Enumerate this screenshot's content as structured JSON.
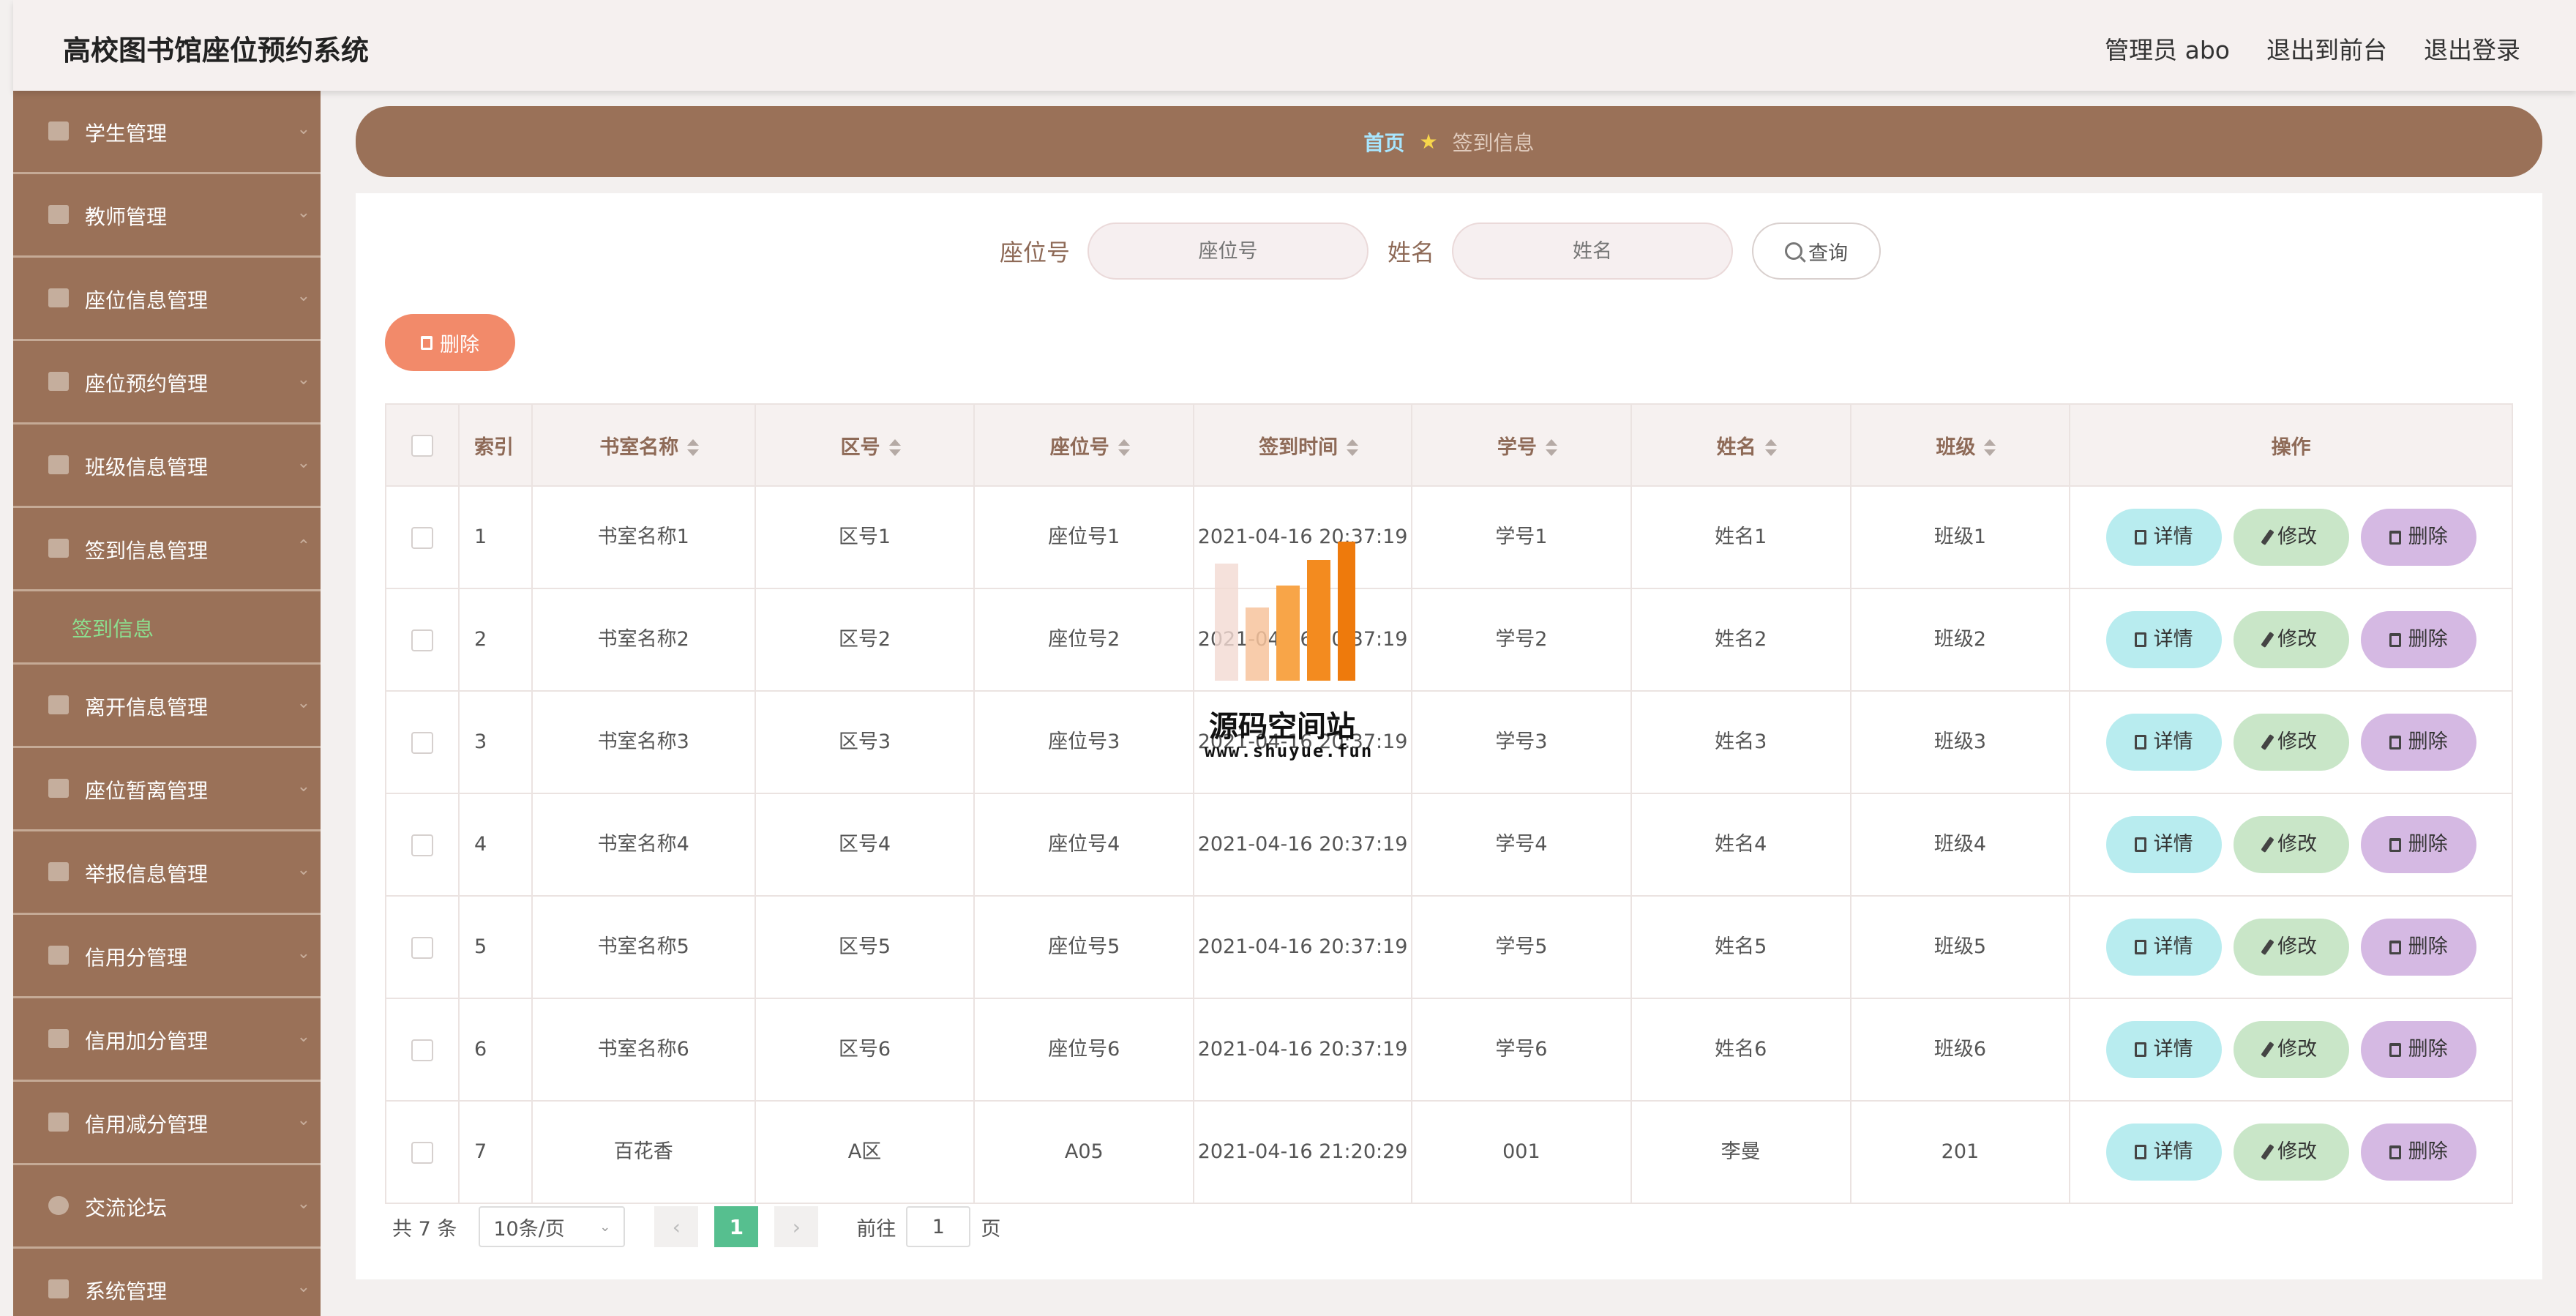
{
  "header": {
    "title": "高校图书馆座位预约系统",
    "links": [
      "管理员 abo",
      "退出到前台",
      "退出登录"
    ]
  },
  "sidebar": {
    "items": [
      {
        "label": "学生管理",
        "icon": "grid-icon"
      },
      {
        "label": "教师管理",
        "icon": "user-icon"
      },
      {
        "label": "座位信息管理",
        "icon": "send-icon"
      },
      {
        "label": "座位预约管理",
        "icon": "checklist-icon"
      },
      {
        "label": "班级信息管理",
        "icon": "send-icon"
      },
      {
        "label": "签到信息管理",
        "icon": "printer-icon",
        "expanded": true,
        "children": [
          "签到信息"
        ]
      },
      {
        "label": "离开信息管理",
        "icon": "briefcase-icon"
      },
      {
        "label": "座位暂离管理",
        "icon": "clipboard-icon"
      },
      {
        "label": "举报信息管理",
        "icon": "crop-icon"
      },
      {
        "label": "信用分管理",
        "icon": "video-icon"
      },
      {
        "label": "信用加分管理",
        "icon": "message-icon"
      },
      {
        "label": "信用减分管理",
        "icon": "cancel-icon"
      },
      {
        "label": "交流论坛",
        "icon": "compass-icon"
      },
      {
        "label": "系统管理",
        "icon": "card-icon"
      }
    ]
  },
  "breadcrumb": {
    "home": "首页",
    "current": "签到信息"
  },
  "search": {
    "seat_label": "座位号",
    "seat_placeholder": "座位号",
    "name_label": "姓名",
    "name_placeholder": "姓名",
    "button": "查询"
  },
  "toolbar": {
    "delete_label": "删除"
  },
  "table": {
    "headers": [
      "索引",
      "书室名称",
      "区号",
      "座位号",
      "签到时间",
      "学号",
      "姓名",
      "班级",
      "操作"
    ],
    "rows": [
      {
        "index": "1",
        "room": "书室名称1",
        "zone": "区号1",
        "seat": "座位号1",
        "time": "2021-04-16 20:37:19",
        "sid": "学号1",
        "name": "姓名1",
        "class": "班级1"
      },
      {
        "index": "2",
        "room": "书室名称2",
        "zone": "区号2",
        "seat": "座位号2",
        "time": "2021-04-16 20:37:19",
        "sid": "学号2",
        "name": "姓名2",
        "class": "班级2"
      },
      {
        "index": "3",
        "room": "书室名称3",
        "zone": "区号3",
        "seat": "座位号3",
        "time": "2021-04-16 20:37:19",
        "sid": "学号3",
        "name": "姓名3",
        "class": "班级3"
      },
      {
        "index": "4",
        "room": "书室名称4",
        "zone": "区号4",
        "seat": "座位号4",
        "time": "2021-04-16 20:37:19",
        "sid": "学号4",
        "name": "姓名4",
        "class": "班级4"
      },
      {
        "index": "5",
        "room": "书室名称5",
        "zone": "区号5",
        "seat": "座位号5",
        "time": "2021-04-16 20:37:19",
        "sid": "学号5",
        "name": "姓名5",
        "class": "班级5"
      },
      {
        "index": "6",
        "room": "书室名称6",
        "zone": "区号6",
        "seat": "座位号6",
        "time": "2021-04-16 20:37:19",
        "sid": "学号6",
        "name": "姓名6",
        "class": "班级6"
      },
      {
        "index": "7",
        "room": "百花香",
        "zone": "A区",
        "seat": "A05",
        "time": "2021-04-16 21:20:29",
        "sid": "001",
        "name": "李曼",
        "class": "201"
      }
    ],
    "actions": {
      "detail": "详情",
      "edit": "修改",
      "delete": "删除"
    }
  },
  "pagination": {
    "total": "共 7 条",
    "page_size": "10条/页",
    "current_page": "1",
    "goto_label": "前往",
    "goto_value": "1",
    "page_suffix": "页"
  },
  "watermark": {
    "title": "源码空间站",
    "url": "www.shuyue.fun"
  },
  "colors": {
    "sidebar_bg": "#9a7158",
    "accent_green": "#56bf8f",
    "delete_orange": "#f28a6a",
    "detail_cyan": "#b8ecef",
    "edit_green": "#c9e6c8",
    "remove_purple": "#d5b9e3"
  }
}
